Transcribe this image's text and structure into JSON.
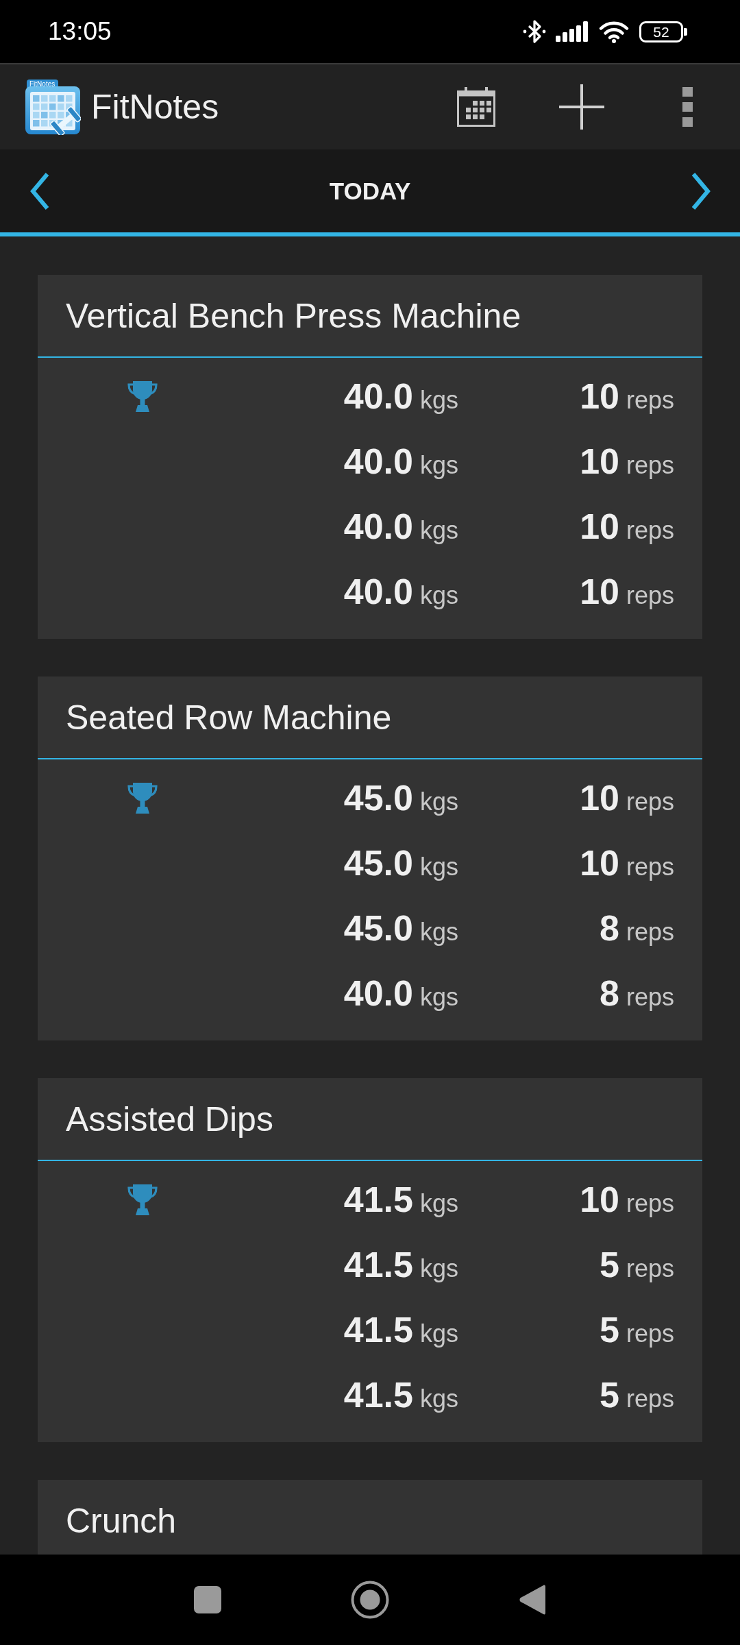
{
  "status_bar": {
    "time": "13:05",
    "battery": "52"
  },
  "app_bar": {
    "logo_label": "FitNotes",
    "title": "FitNotes"
  },
  "date_nav": {
    "label": "TODAY"
  },
  "workouts": [
    {
      "exercise": "Vertical Bench Press Machine",
      "sets": [
        {
          "weight": "40.0",
          "weight_unit": "kgs",
          "reps": "10",
          "reps_unit": "reps",
          "personal_record": true
        },
        {
          "weight": "40.0",
          "weight_unit": "kgs",
          "reps": "10",
          "reps_unit": "reps",
          "personal_record": false
        },
        {
          "weight": "40.0",
          "weight_unit": "kgs",
          "reps": "10",
          "reps_unit": "reps",
          "personal_record": false
        },
        {
          "weight": "40.0",
          "weight_unit": "kgs",
          "reps": "10",
          "reps_unit": "reps",
          "personal_record": false
        }
      ]
    },
    {
      "exercise": "Seated Row Machine",
      "sets": [
        {
          "weight": "45.0",
          "weight_unit": "kgs",
          "reps": "10",
          "reps_unit": "reps",
          "personal_record": true
        },
        {
          "weight": "45.0",
          "weight_unit": "kgs",
          "reps": "10",
          "reps_unit": "reps",
          "personal_record": false
        },
        {
          "weight": "45.0",
          "weight_unit": "kgs",
          "reps": "8",
          "reps_unit": "reps",
          "personal_record": false
        },
        {
          "weight": "40.0",
          "weight_unit": "kgs",
          "reps": "8",
          "reps_unit": "reps",
          "personal_record": false
        }
      ]
    },
    {
      "exercise": "Assisted Dips",
      "sets": [
        {
          "weight": "41.5",
          "weight_unit": "kgs",
          "reps": "10",
          "reps_unit": "reps",
          "personal_record": true
        },
        {
          "weight": "41.5",
          "weight_unit": "kgs",
          "reps": "5",
          "reps_unit": "reps",
          "personal_record": false
        },
        {
          "weight": "41.5",
          "weight_unit": "kgs",
          "reps": "5",
          "reps_unit": "reps",
          "personal_record": false
        },
        {
          "weight": "41.5",
          "weight_unit": "kgs",
          "reps": "5",
          "reps_unit": "reps",
          "personal_record": false
        }
      ]
    },
    {
      "exercise": "Crunch"
    }
  ]
}
